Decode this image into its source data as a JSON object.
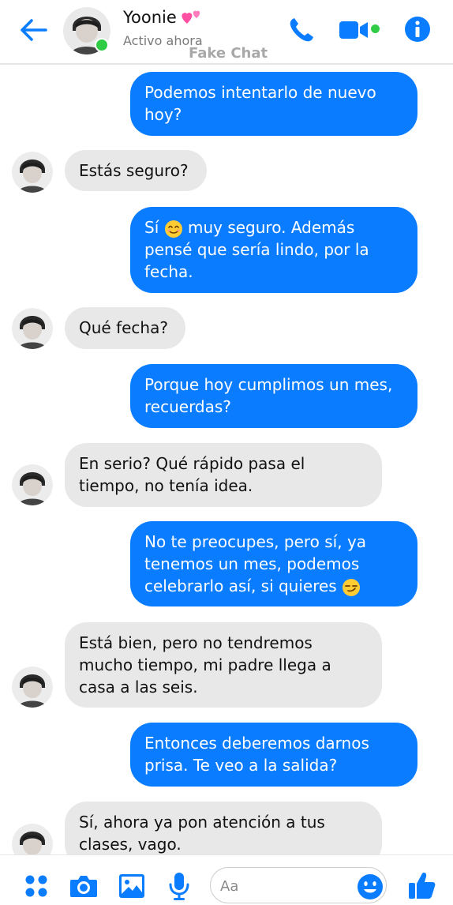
{
  "header": {
    "contact_name": "Yoonie",
    "status": "Activo ahora",
    "watermark": "Fake Chat"
  },
  "messages": [
    {
      "from": "me",
      "text": "Podemos intentarlo de nuevo hoy?"
    },
    {
      "from": "contact",
      "text": "Estás seguro?"
    },
    {
      "from": "me",
      "text_before_emoji": "Sí",
      "emoji": "smiling-face-emoji",
      "text_after_emoji": " muy seguro. Además pensé que sería lindo, por la fecha."
    },
    {
      "from": "contact",
      "text": "Qué fecha?"
    },
    {
      "from": "me",
      "text": "Porque hoy cumplimos un mes, recuerdas?"
    },
    {
      "from": "contact",
      "text": "En serio? Qué rápido pasa el tiempo, no tenía idea."
    },
    {
      "from": "me",
      "text": "No te preocupes, pero sí, ya tenemos un mes, podemos celebrarlo así, si quieres",
      "emoji": "smirking-face-emoji"
    },
    {
      "from": "contact",
      "text": "Está bien, pero no tendremos mucho tiempo, mi padre llega a casa a las seis."
    },
    {
      "from": "me",
      "text": "Entonces deberemos darnos prisa. Te veo a la salida?"
    },
    {
      "from": "contact",
      "text": "Sí, ahora ya pon atención a tus clases, vago."
    }
  ],
  "composer": {
    "placeholder": "Aa",
    "value": ""
  },
  "icons": {
    "back": "arrow-left-icon",
    "call": "phone-icon",
    "video": "video-camera-icon",
    "info": "info-icon",
    "menu": "four-dots-icon",
    "camera": "camera-icon",
    "gallery": "image-icon",
    "mic": "microphone-icon",
    "emoji": "smiley-icon",
    "like": "thumbs-up-icon"
  },
  "colors": {
    "accent": "#0a7cff",
    "incoming_bubble": "#e8e8e8",
    "online": "#31cc46"
  }
}
